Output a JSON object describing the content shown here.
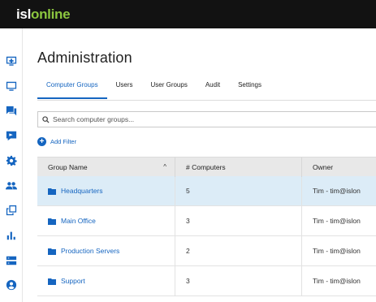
{
  "brand": {
    "part1": "isl",
    "part2": "online"
  },
  "sidebar": {
    "items": [
      {
        "icon": "remote-desktop-icon"
      },
      {
        "icon": "monitor-icon"
      },
      {
        "icon": "chat-icon"
      },
      {
        "icon": "video-icon"
      },
      {
        "icon": "gear-icon"
      },
      {
        "icon": "users-icon"
      },
      {
        "icon": "copy-icon"
      },
      {
        "icon": "bar-chart-icon"
      },
      {
        "icon": "server-icon"
      },
      {
        "icon": "account-icon"
      }
    ]
  },
  "page": {
    "title": "Administration"
  },
  "tabs": [
    {
      "label": "Computer Groups",
      "active": true
    },
    {
      "label": "Users",
      "active": false
    },
    {
      "label": "User Groups",
      "active": false
    },
    {
      "label": "Audit",
      "active": false
    },
    {
      "label": "Settings",
      "active": false
    }
  ],
  "search": {
    "placeholder": "Search computer groups..."
  },
  "filter": {
    "label": "Add Filter"
  },
  "table": {
    "headers": {
      "name": "Group Name",
      "count": "# Computers",
      "owner": "Owner"
    },
    "rows": [
      {
        "name": "Headquarters",
        "count": "5",
        "owner": "Tim - tim@islon",
        "selected": true
      },
      {
        "name": "Main Office",
        "count": "3",
        "owner": "Tim - tim@islon",
        "selected": false
      },
      {
        "name": "Production Servers",
        "count": "2",
        "owner": "Tim - tim@islon",
        "selected": false
      },
      {
        "name": "Support",
        "count": "3",
        "owner": "Tim - tim@islon",
        "selected": false
      }
    ]
  },
  "colors": {
    "accent": "#1565c0",
    "brand_green": "#8cc63f",
    "topbar": "#121212",
    "selected_row": "#dcecf7"
  }
}
